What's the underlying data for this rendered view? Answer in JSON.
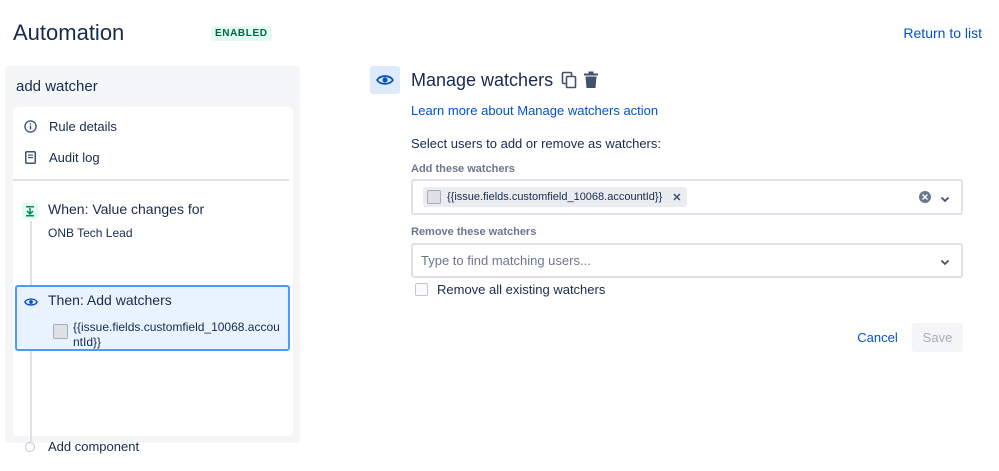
{
  "header": {
    "title": "Automation",
    "status_badge": "ENABLED",
    "return_link": "Return to list"
  },
  "sidebar": {
    "rule_name": "add watcher",
    "nav": [
      {
        "label": "Rule details",
        "icon": "info-icon"
      },
      {
        "label": "Audit log",
        "icon": "document-icon"
      }
    ],
    "trigger": {
      "icon": "trigger-icon",
      "title": "When: Value changes for",
      "subtitle": "ONB Tech Lead"
    },
    "action": {
      "icon": "eye-icon",
      "title": "Then: Add watchers",
      "field": "{{issue.fields.customfield_10068.accountId}}"
    },
    "add_component": "Add component"
  },
  "editor": {
    "title": "Manage watchers",
    "learn_more": "Learn more about Manage watchers action",
    "instructions": "Select users to add or remove as watchers:",
    "add_watchers": {
      "label": "Add these watchers",
      "chip": "{{issue.fields.customfield_10068.accountId}}"
    },
    "remove_watchers": {
      "label": "Remove these watchers",
      "placeholder": "Type to find matching users..."
    },
    "remove_all": {
      "label": "Remove all existing watchers",
      "checked": false
    },
    "cancel_label": "Cancel",
    "save_label": "Save"
  },
  "colors": {
    "link": "#0052cc",
    "badge_bg": "#e3fcef",
    "badge_text": "#006644",
    "selected_border": "#4c9aff",
    "selected_bg": "#e9f2ff"
  }
}
